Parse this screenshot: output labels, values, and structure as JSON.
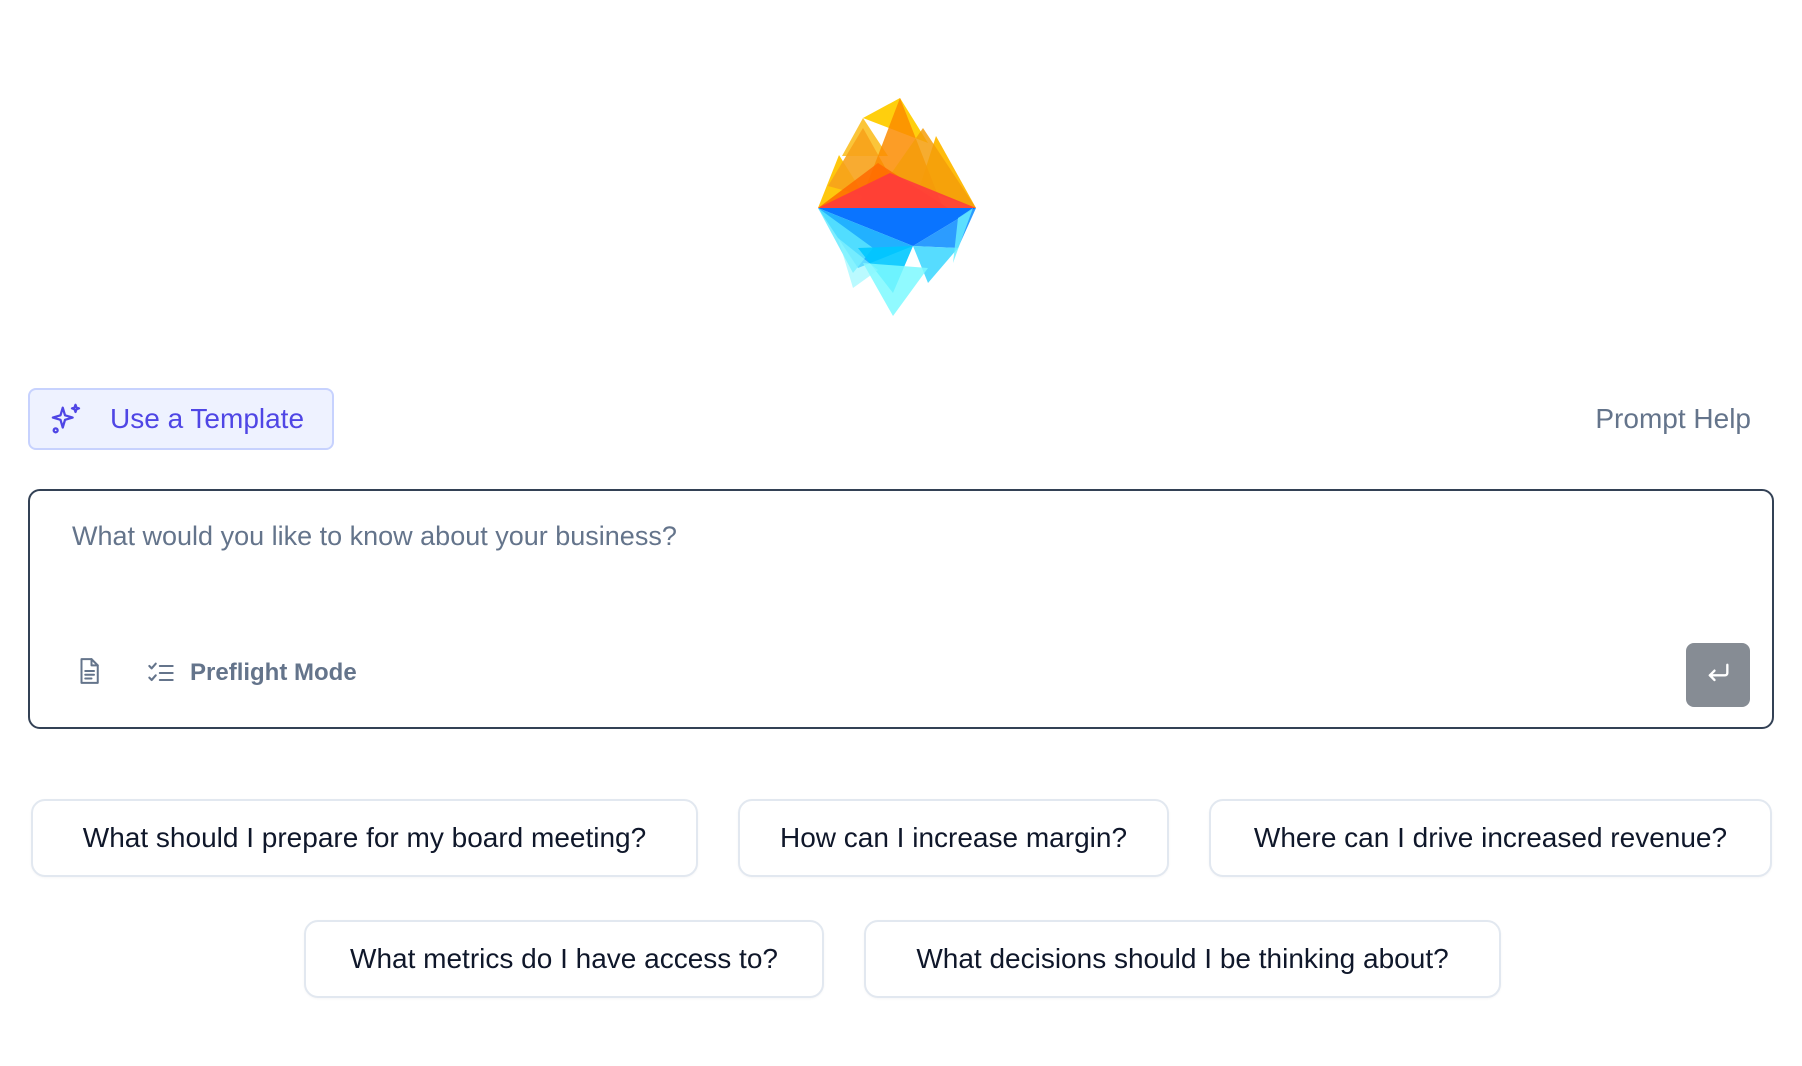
{
  "app": {
    "logo_icon": "iceberg-logo-icon"
  },
  "toolbar": {
    "template_label": "Use a Template",
    "template_icon": "sparkles-icon",
    "prompt_help_label": "Prompt Help"
  },
  "composer": {
    "placeholder": "What would you like to know about your business?",
    "value": "",
    "attach_icon": "document-icon",
    "preflight_label": "Preflight Mode",
    "preflight_icon": "checklist-icon",
    "send_icon": "enter-icon"
  },
  "suggestions": [
    "What should I prepare for my board meeting?",
    "How can I increase margin?",
    "Where can I drive increased revenue?",
    "What metrics do I have access to?",
    "What decisions should I be thinking about?"
  ],
  "colors": {
    "accent": "#4f46e5",
    "accent_bg": "#eef2ff",
    "muted_text": "#64748b",
    "send_button": "#868c94",
    "composer_border": "#334155"
  }
}
